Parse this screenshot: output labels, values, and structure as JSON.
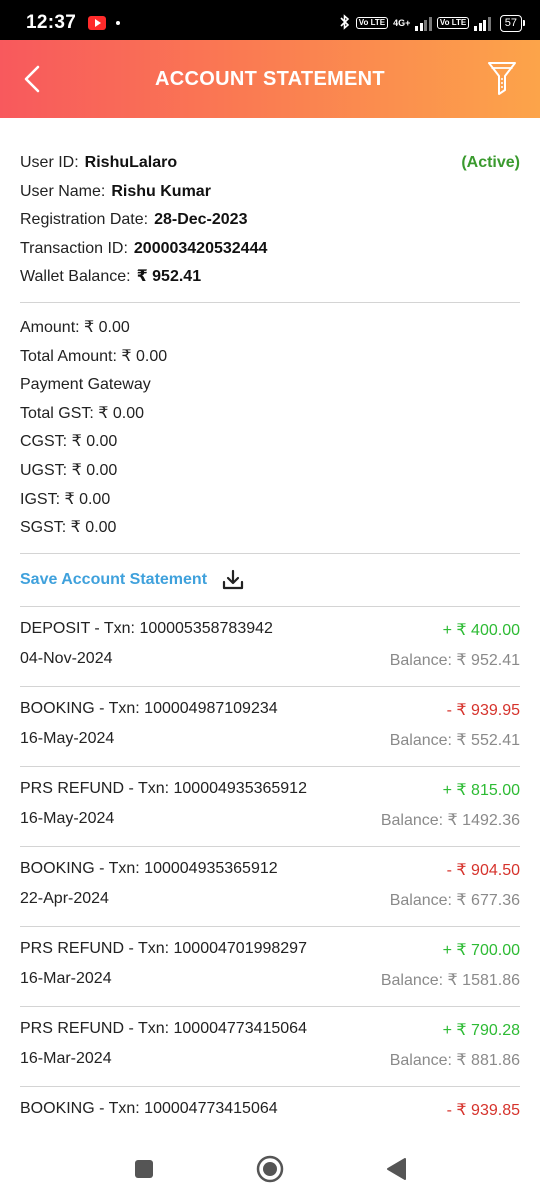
{
  "status_bar": {
    "time": "12:37",
    "network": "4G+",
    "volte_label": "Vo LTE",
    "battery": "57"
  },
  "header": {
    "title": "ACCOUNT STATEMENT"
  },
  "user": {
    "status": "(Active)",
    "fields": [
      {
        "label": "User ID:",
        "value": "RishuLalaro"
      },
      {
        "label": "User Name:",
        "value": "Rishu Kumar"
      },
      {
        "label": "Registration Date:",
        "value": "28-Dec-2023"
      },
      {
        "label": "Transaction ID:",
        "value": "200003420532444"
      },
      {
        "label": "Wallet Balance:",
        "value": "₹ 952.41"
      }
    ]
  },
  "amounts": {
    "amount": "Amount:  ₹ 0.00",
    "total_amount": "Total Amount:  ₹ 0.00",
    "payment_gateway": "Payment Gateway",
    "total_gst": "Total GST:  ₹ 0.00",
    "cgst": "CGST:  ₹ 0.00",
    "ugst": "UGST:  ₹ 0.00",
    "igst": "IGST:  ₹ 0.00",
    "sgst": "SGST:  ₹ 0.00"
  },
  "save_label": "Save Account Statement",
  "transactions": [
    {
      "desc": "DEPOSIT - Txn: 100005358783942",
      "date": "04-Nov-2024",
      "amount": "+ ₹ 400.00",
      "balance": "Balance: ₹ 952.41",
      "type": "credit"
    },
    {
      "desc": "BOOKING - Txn: 100004987109234",
      "date": "16-May-2024",
      "amount": "- ₹ 939.95",
      "balance": "Balance: ₹ 552.41",
      "type": "debit"
    },
    {
      "desc": "PRS REFUND - Txn: 100004935365912",
      "date": "16-May-2024",
      "amount": "+ ₹ 815.00",
      "balance": "Balance: ₹ 1492.36",
      "type": "credit"
    },
    {
      "desc": "BOOKING - Txn: 100004935365912",
      "date": "22-Apr-2024",
      "amount": "- ₹ 904.50",
      "balance": "Balance: ₹ 677.36",
      "type": "debit"
    },
    {
      "desc": "PRS REFUND - Txn: 100004701998297",
      "date": "16-Mar-2024",
      "amount": "+ ₹ 700.00",
      "balance": "Balance: ₹ 1581.86",
      "type": "credit"
    },
    {
      "desc": "PRS REFUND - Txn: 100004773415064",
      "date": "16-Mar-2024",
      "amount": "+ ₹ 790.28",
      "balance": "Balance: ₹ 881.86",
      "type": "credit"
    },
    {
      "desc": "BOOKING - Txn: 100004773415064",
      "date": "",
      "amount": "- ₹ 939.85",
      "balance": "",
      "type": "debit"
    }
  ],
  "colors": {
    "header_start": "#f8595d",
    "header_end": "#fca44a",
    "active": "#3a9a2e",
    "credit": "#2dbb34",
    "debit": "#d6332c",
    "link": "#3fa1dc"
  }
}
